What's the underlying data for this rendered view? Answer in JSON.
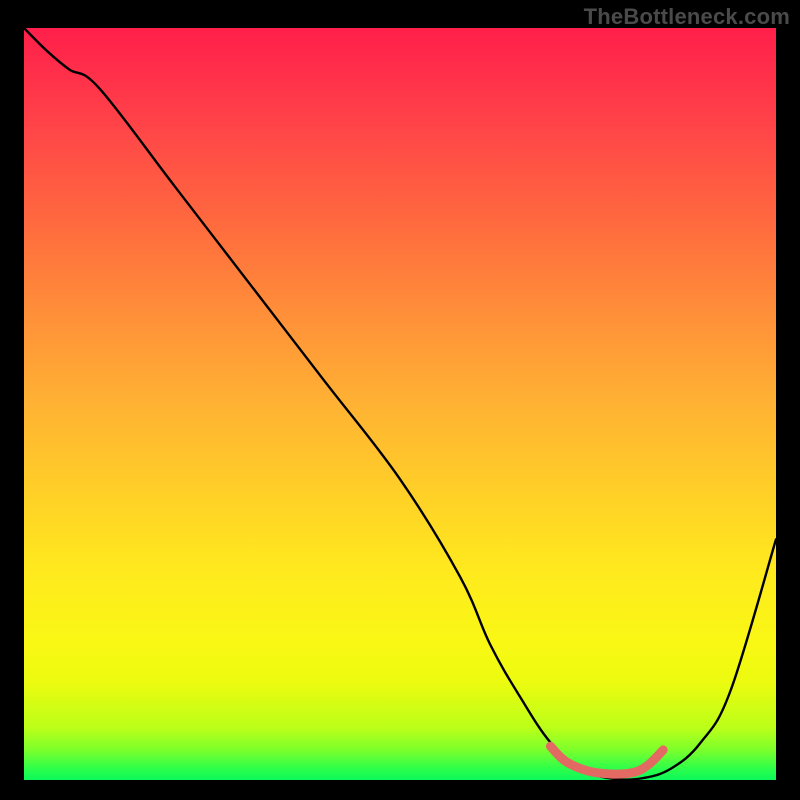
{
  "watermark": "TheBottleneck.com",
  "colors": {
    "page_bg": "#000000",
    "curve": "#000000",
    "highlight": "#e26a62",
    "gradient_top": "#ff1f4a",
    "gradient_bottom": "#0cf85c"
  },
  "chart_data": {
    "type": "line",
    "title": "",
    "xlabel": "",
    "ylabel": "",
    "xlim": [
      0,
      100
    ],
    "ylim": [
      0,
      100
    ],
    "grid": false,
    "legend": false,
    "series": [
      {
        "name": "bottleneck-curve",
        "x": [
          0,
          3,
          6,
          10,
          20,
          30,
          40,
          50,
          58,
          62,
          66,
          70,
          74,
          78,
          82,
          86,
          90,
          94,
          100
        ],
        "y": [
          100,
          97,
          94.5,
          92,
          79,
          66,
          53,
          40,
          27,
          18,
          11,
          5,
          1.5,
          0.2,
          0.2,
          1.5,
          5,
          12,
          32
        ]
      },
      {
        "name": "minimum-highlight",
        "x": [
          70,
          72,
          75,
          78,
          81,
          83,
          85
        ],
        "y": [
          4.5,
          2.5,
          1.2,
          0.8,
          1.0,
          2.0,
          4.0
        ]
      }
    ],
    "annotations": []
  }
}
